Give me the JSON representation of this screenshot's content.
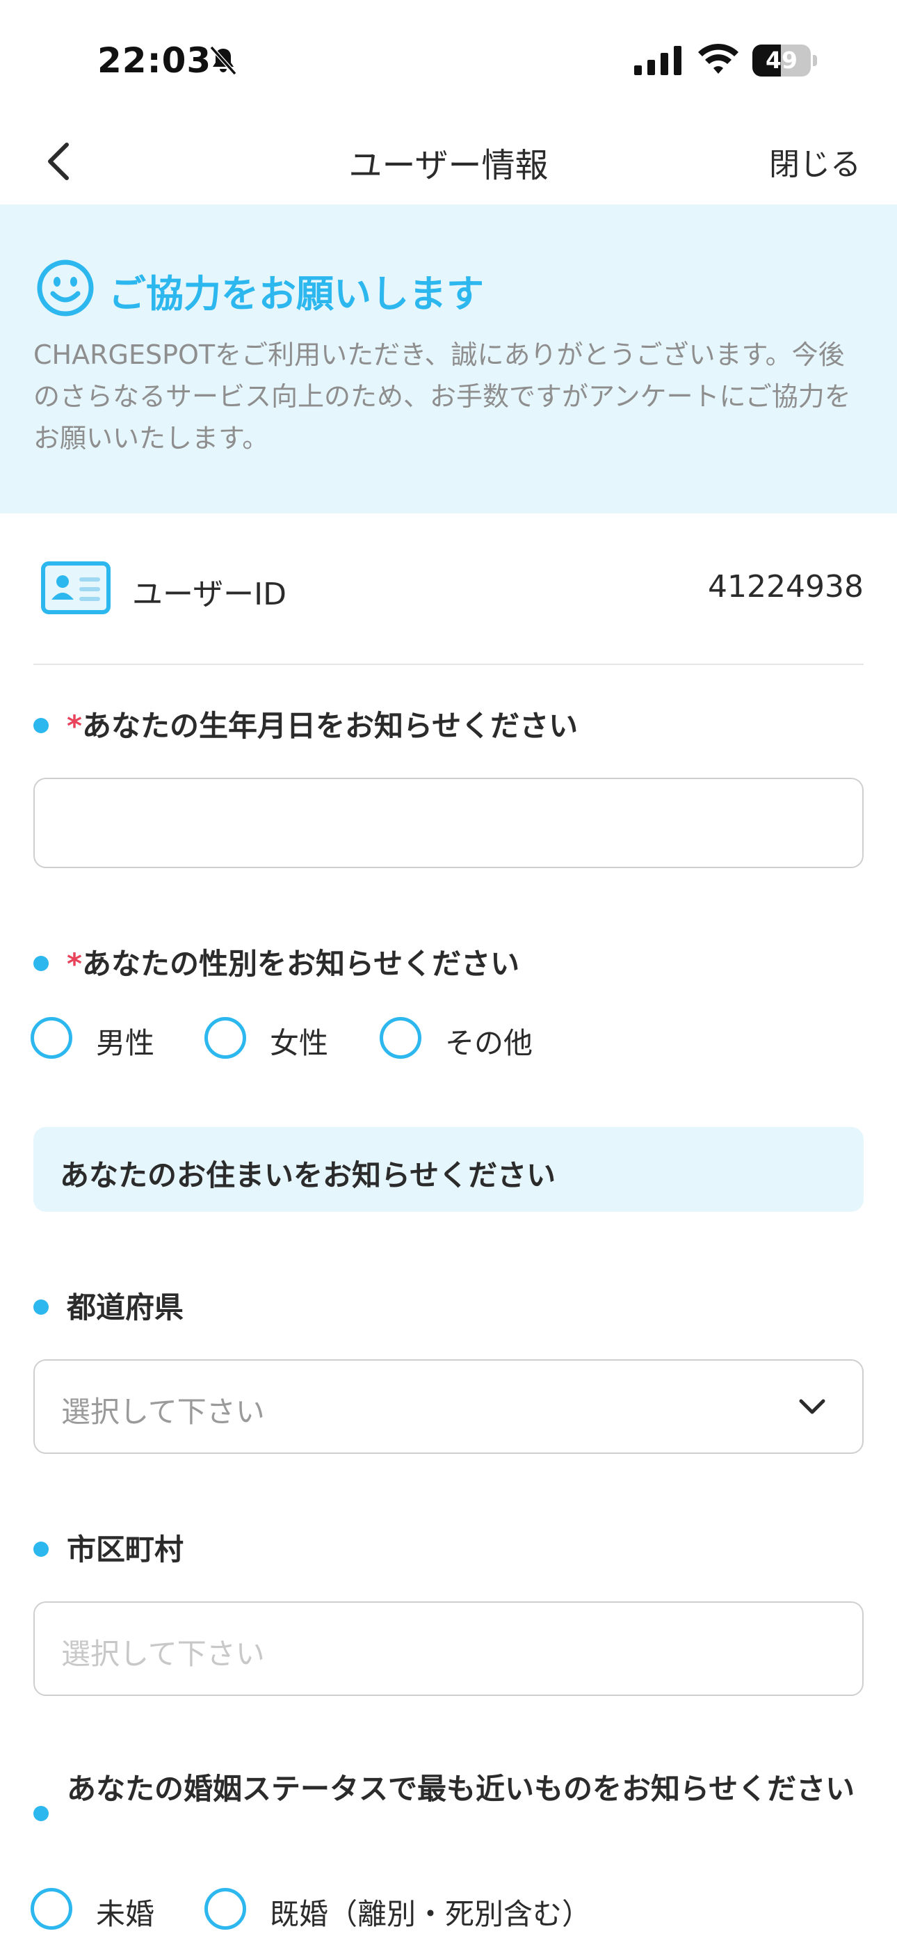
{
  "status_bar": {
    "time": "22:03",
    "battery_level": "49",
    "battery_fraction": 0.49,
    "icons": [
      "bell-slash-icon",
      "signal-icon",
      "wifi-icon",
      "battery-icon"
    ]
  },
  "nav": {
    "back_icon": "chevron-left-icon",
    "title": "ユーザー情報",
    "close_label": "閉じる"
  },
  "banner": {
    "icon": "smile-icon",
    "title": "ご協力をお願いします",
    "body": "CHARGESPOTをご利用いただき、誠にありがとうございます。今後のさらなるサービス向上のため、お手数ですがアンケートにご協力をお願いいたします。"
  },
  "user": {
    "icon": "id-card-icon",
    "id_label": "ユーザーID",
    "id_value": "41224938"
  },
  "form": {
    "birthdate": {
      "required_mark": "*",
      "label": "あなたの生年月日をお知らせください",
      "value": ""
    },
    "gender": {
      "required_mark": "*",
      "label": "あなたの性別をお知らせください",
      "options": [
        "男性",
        "女性",
        "その他"
      ]
    },
    "residence_heading": "あなたのお住まいをお知らせください",
    "prefecture": {
      "label": "都道府県",
      "placeholder": "選択して下さい"
    },
    "city": {
      "label": "市区町村",
      "placeholder": "選択して下さい"
    },
    "marital": {
      "label": "あなたの婚姻ステータスで最も近いものをお知らせください",
      "options": [
        "未婚",
        "既婚（離別・死別含む）"
      ]
    }
  },
  "colors": {
    "accent": "#2db7ef",
    "banner_bg": "#e6f6fd",
    "required": "#e8435a",
    "muted_text": "#8e8e8e",
    "placeholder_active": "#9a9a9a",
    "placeholder_disabled": "#c8c8c8"
  }
}
